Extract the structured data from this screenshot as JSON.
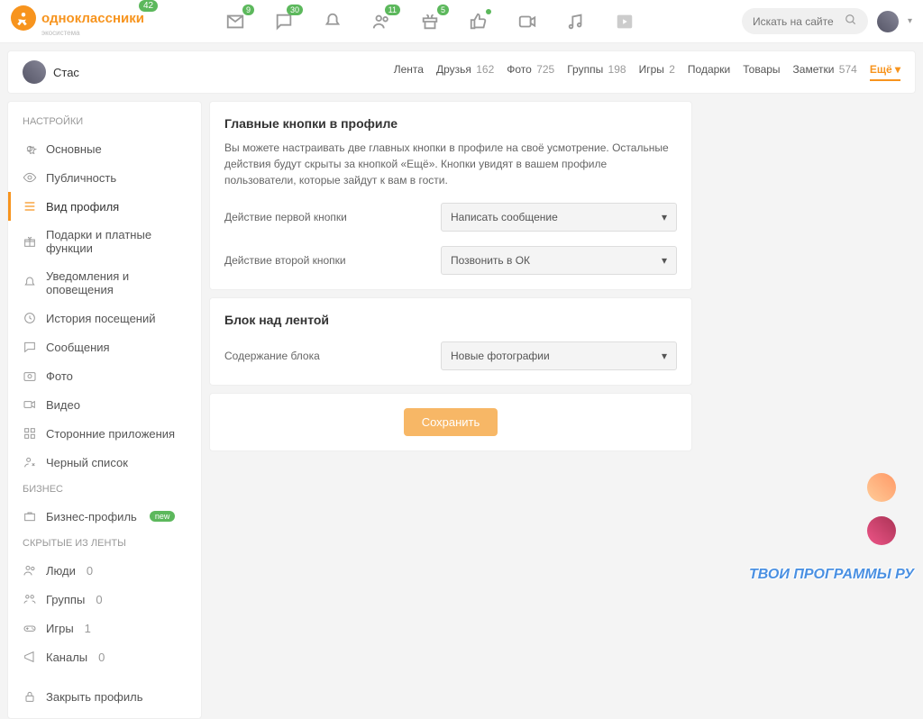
{
  "header": {
    "logo_text": "одноклассники",
    "logo_sub": "экосистема",
    "logo_badge": "42",
    "search_placeholder": "Искать на сайте",
    "nav_badges": {
      "mail": "9",
      "chat": "30",
      "friends": "11",
      "gifts": "5"
    }
  },
  "user": {
    "name": "Стас"
  },
  "tabs": [
    {
      "label": "Лента",
      "count": ""
    },
    {
      "label": "Друзья",
      "count": "162"
    },
    {
      "label": "Фото",
      "count": "725"
    },
    {
      "label": "Группы",
      "count": "198"
    },
    {
      "label": "Игры",
      "count": "2"
    },
    {
      "label": "Подарки",
      "count": ""
    },
    {
      "label": "Товары",
      "count": ""
    },
    {
      "label": "Заметки",
      "count": "574"
    },
    {
      "label": "Ещё",
      "count": "",
      "more": true
    }
  ],
  "sidebar": {
    "title_settings": "НАСТРОЙКИ",
    "title_business": "БИЗНЕС",
    "title_hidden": "СКРЫТЫЕ ИЗ ЛЕНТЫ",
    "items_settings": [
      {
        "icon": "gear",
        "label": "Основные"
      },
      {
        "icon": "eye",
        "label": "Публичность"
      },
      {
        "icon": "list",
        "label": "Вид профиля",
        "active": true
      },
      {
        "icon": "gift",
        "label": "Подарки и платные функции"
      },
      {
        "icon": "bell",
        "label": "Уведомления и оповещения"
      },
      {
        "icon": "clock",
        "label": "История посещений"
      },
      {
        "icon": "msg",
        "label": "Сообщения"
      },
      {
        "icon": "camera",
        "label": "Фото"
      },
      {
        "icon": "video",
        "label": "Видео"
      },
      {
        "icon": "apps",
        "label": "Сторонние приложения"
      },
      {
        "icon": "person",
        "label": "Черный список"
      }
    ],
    "business": {
      "label": "Бизнес-профиль",
      "badge": "new"
    },
    "items_hidden": [
      {
        "icon": "people",
        "label": "Люди",
        "count": "0"
      },
      {
        "icon": "group",
        "label": "Группы",
        "count": "0"
      },
      {
        "icon": "game",
        "label": "Игры",
        "count": "1"
      },
      {
        "icon": "channel",
        "label": "Каналы",
        "count": "0"
      }
    ],
    "lock": {
      "label": "Закрыть профиль"
    }
  },
  "main": {
    "panel1": {
      "title": "Главные кнопки в профиле",
      "desc": "Вы можете настраивать две главных кнопки в профиле на своё усмотрение. Остальные действия будут скрыты за кнопкой «Ещё». Кнопки увидят в вашем профиле пользователи, которые зайдут к вам в гости.",
      "row1_label": "Действие первой кнопки",
      "row1_value": "Написать сообщение",
      "row2_label": "Действие второй кнопки",
      "row2_value": "Позвонить в ОК"
    },
    "panel2": {
      "title": "Блок над лентой",
      "row1_label": "Содержание блока",
      "row1_value": "Новые фотографии"
    },
    "save_label": "Сохранить"
  },
  "watermark": "ТВОИ ПРОГРАММЫ РУ"
}
